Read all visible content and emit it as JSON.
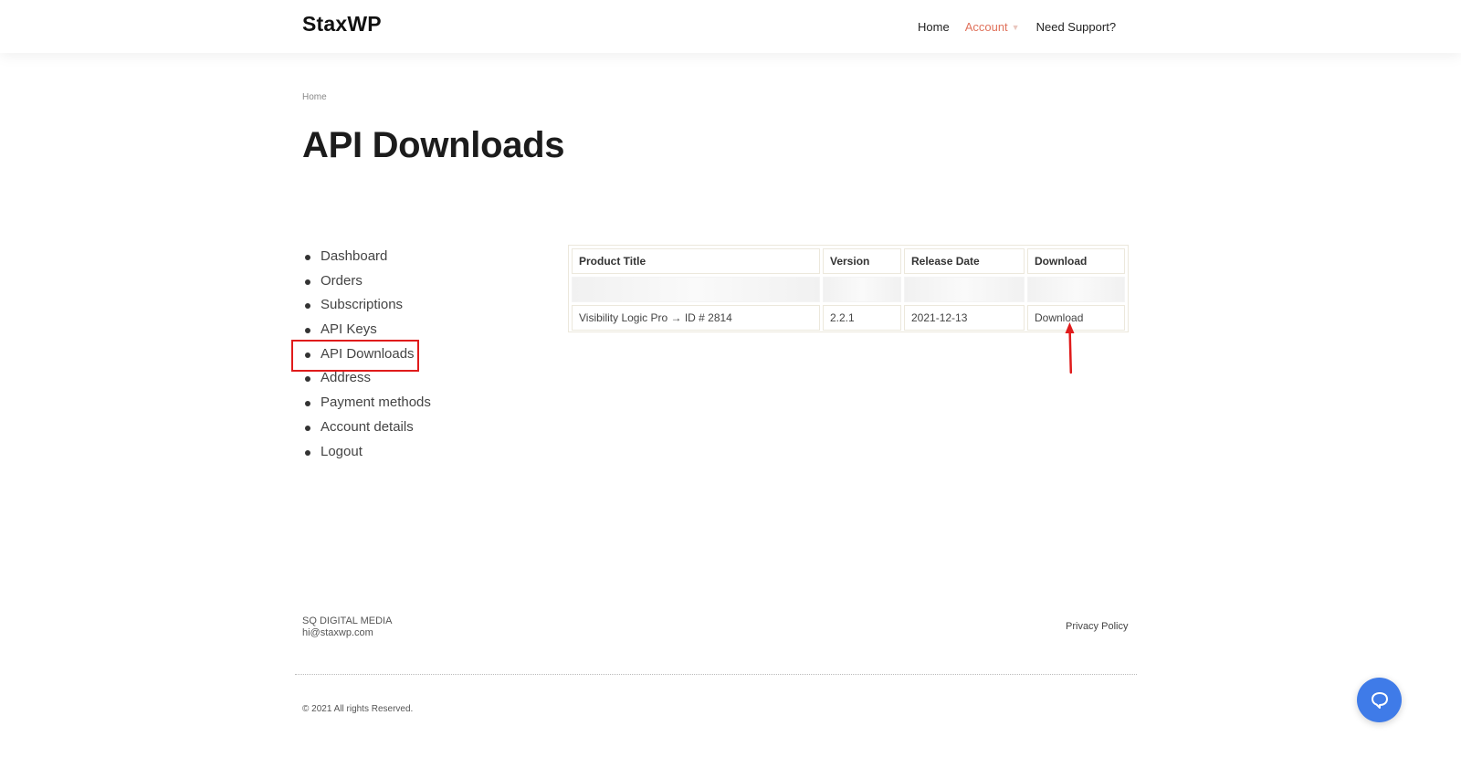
{
  "header": {
    "logo": "StaxWP",
    "nav": {
      "home": "Home",
      "account": "Account",
      "support": "Need Support?"
    }
  },
  "breadcrumb": "Home",
  "page_title": "API Downloads",
  "account_menu": [
    "Dashboard",
    "Orders",
    "Subscriptions",
    "API Keys",
    "API Downloads",
    "Address",
    "Payment methods",
    "Account details",
    "Logout"
  ],
  "table": {
    "headers": [
      "Product Title",
      "Version",
      "Release Date",
      "Download"
    ],
    "rows": [
      {
        "product": "Visibility Logic Pro → ID # 2814",
        "version": "2.2.1",
        "release_date": "2021-12-13",
        "download": "Download"
      }
    ]
  },
  "footer": {
    "company": "SQ DIGITAL MEDIA",
    "email": "hi@staxwp.com",
    "privacy": "Privacy Policy",
    "copyright": "© 2021 All rights Reserved."
  },
  "colors": {
    "accent": "#e0725c",
    "highlight": "#e01b1b",
    "chat": "#3f7be8"
  }
}
